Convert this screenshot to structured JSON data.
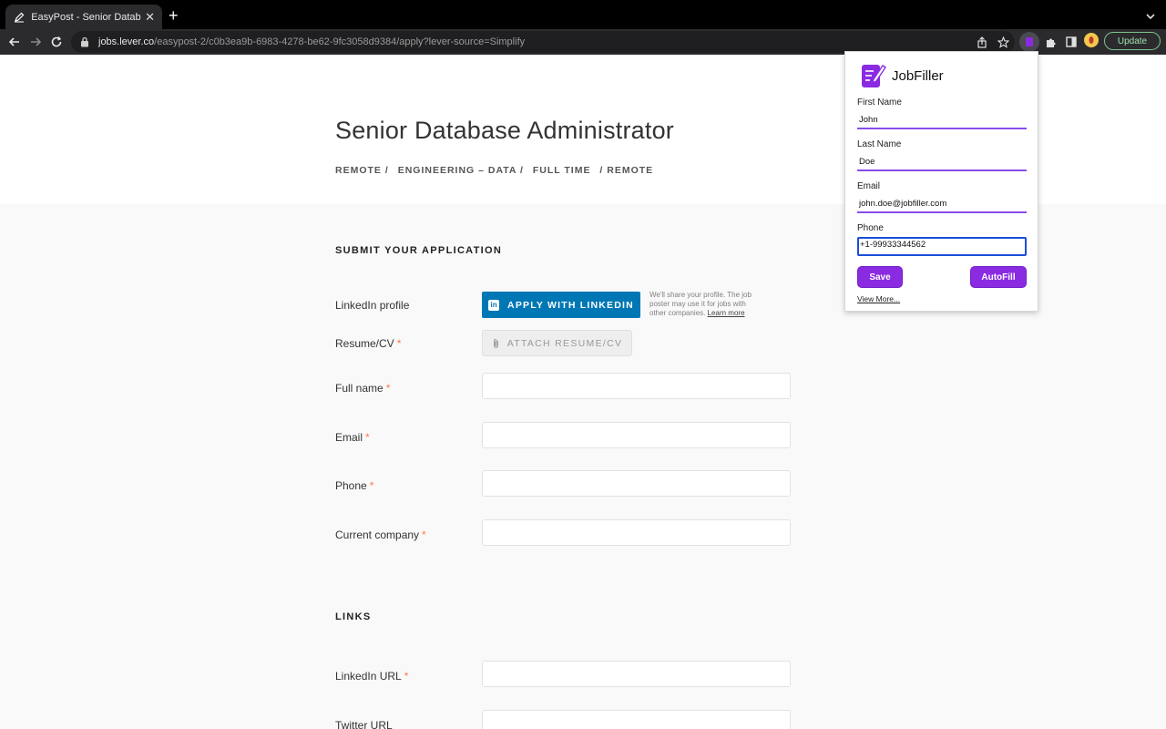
{
  "browser": {
    "tab_title": "EasyPost - Senior Database Ad",
    "url_host": "jobs.lever.co",
    "url_path": "/easypost-2/c0b3ea9b-6983-4278-be62-9fc3058d9384/apply?lever-source=Simplify",
    "update_label": "Update"
  },
  "job": {
    "title": "Senior Database Administrator",
    "categories": [
      "REMOTE /",
      "ENGINEERING – DATA /",
      "FULL TIME",
      "/ REMOTE"
    ]
  },
  "form": {
    "section_title": "SUBMIT YOUR APPLICATION",
    "linkedin_label": "LinkedIn profile",
    "linkedin_button": "APPLY WITH LINKEDIN",
    "linkedin_note": "We'll share your profile. The job poster may use it for jobs with other companies.",
    "linkedin_learn_more": "Learn more",
    "resume_label": "Resume/CV",
    "attach_button": "ATTACH RESUME/CV",
    "fields": [
      {
        "label": "Full name",
        "value": ""
      },
      {
        "label": "Email",
        "value": ""
      },
      {
        "label": "Phone",
        "value": ""
      },
      {
        "label": "Current company",
        "value": ""
      }
    ],
    "required_mark": "*",
    "links_title": "LINKS",
    "links": [
      {
        "label": "LinkedIn URL",
        "value": ""
      },
      {
        "label": "Twitter URL",
        "value": ""
      }
    ]
  },
  "popup": {
    "title": "JobFiller",
    "first_name_label": "First Name",
    "first_name": "John",
    "last_name_label": "Last Name",
    "last_name": "Doe",
    "email_label": "Email",
    "email": "john.doe@jobfiller.com",
    "phone_label": "Phone",
    "phone": "+1-99933344562",
    "save_label": "Save",
    "autofill_label": "AutoFill",
    "view_more_label": "View More...",
    "accent_color": "#8a2be2"
  }
}
